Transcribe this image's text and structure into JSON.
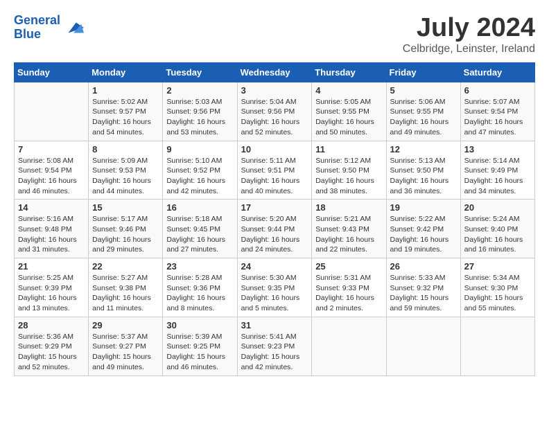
{
  "header": {
    "logo_line1": "General",
    "logo_line2": "Blue",
    "month_title": "July 2024",
    "subtitle": "Celbridge, Leinster, Ireland"
  },
  "days_of_week": [
    "Sunday",
    "Monday",
    "Tuesday",
    "Wednesday",
    "Thursday",
    "Friday",
    "Saturday"
  ],
  "weeks": [
    [
      {
        "day": "",
        "info": ""
      },
      {
        "day": "1",
        "info": "Sunrise: 5:02 AM\nSunset: 9:57 PM\nDaylight: 16 hours\nand 54 minutes."
      },
      {
        "day": "2",
        "info": "Sunrise: 5:03 AM\nSunset: 9:56 PM\nDaylight: 16 hours\nand 53 minutes."
      },
      {
        "day": "3",
        "info": "Sunrise: 5:04 AM\nSunset: 9:56 PM\nDaylight: 16 hours\nand 52 minutes."
      },
      {
        "day": "4",
        "info": "Sunrise: 5:05 AM\nSunset: 9:55 PM\nDaylight: 16 hours\nand 50 minutes."
      },
      {
        "day": "5",
        "info": "Sunrise: 5:06 AM\nSunset: 9:55 PM\nDaylight: 16 hours\nand 49 minutes."
      },
      {
        "day": "6",
        "info": "Sunrise: 5:07 AM\nSunset: 9:54 PM\nDaylight: 16 hours\nand 47 minutes."
      }
    ],
    [
      {
        "day": "7",
        "info": "Sunrise: 5:08 AM\nSunset: 9:54 PM\nDaylight: 16 hours\nand 46 minutes."
      },
      {
        "day": "8",
        "info": "Sunrise: 5:09 AM\nSunset: 9:53 PM\nDaylight: 16 hours\nand 44 minutes."
      },
      {
        "day": "9",
        "info": "Sunrise: 5:10 AM\nSunset: 9:52 PM\nDaylight: 16 hours\nand 42 minutes."
      },
      {
        "day": "10",
        "info": "Sunrise: 5:11 AM\nSunset: 9:51 PM\nDaylight: 16 hours\nand 40 minutes."
      },
      {
        "day": "11",
        "info": "Sunrise: 5:12 AM\nSunset: 9:50 PM\nDaylight: 16 hours\nand 38 minutes."
      },
      {
        "day": "12",
        "info": "Sunrise: 5:13 AM\nSunset: 9:50 PM\nDaylight: 16 hours\nand 36 minutes."
      },
      {
        "day": "13",
        "info": "Sunrise: 5:14 AM\nSunset: 9:49 PM\nDaylight: 16 hours\nand 34 minutes."
      }
    ],
    [
      {
        "day": "14",
        "info": "Sunrise: 5:16 AM\nSunset: 9:48 PM\nDaylight: 16 hours\nand 31 minutes."
      },
      {
        "day": "15",
        "info": "Sunrise: 5:17 AM\nSunset: 9:46 PM\nDaylight: 16 hours\nand 29 minutes."
      },
      {
        "day": "16",
        "info": "Sunrise: 5:18 AM\nSunset: 9:45 PM\nDaylight: 16 hours\nand 27 minutes."
      },
      {
        "day": "17",
        "info": "Sunrise: 5:20 AM\nSunset: 9:44 PM\nDaylight: 16 hours\nand 24 minutes."
      },
      {
        "day": "18",
        "info": "Sunrise: 5:21 AM\nSunset: 9:43 PM\nDaylight: 16 hours\nand 22 minutes."
      },
      {
        "day": "19",
        "info": "Sunrise: 5:22 AM\nSunset: 9:42 PM\nDaylight: 16 hours\nand 19 minutes."
      },
      {
        "day": "20",
        "info": "Sunrise: 5:24 AM\nSunset: 9:40 PM\nDaylight: 16 hours\nand 16 minutes."
      }
    ],
    [
      {
        "day": "21",
        "info": "Sunrise: 5:25 AM\nSunset: 9:39 PM\nDaylight: 16 hours\nand 13 minutes."
      },
      {
        "day": "22",
        "info": "Sunrise: 5:27 AM\nSunset: 9:38 PM\nDaylight: 16 hours\nand 11 minutes."
      },
      {
        "day": "23",
        "info": "Sunrise: 5:28 AM\nSunset: 9:36 PM\nDaylight: 16 hours\nand 8 minutes."
      },
      {
        "day": "24",
        "info": "Sunrise: 5:30 AM\nSunset: 9:35 PM\nDaylight: 16 hours\nand 5 minutes."
      },
      {
        "day": "25",
        "info": "Sunrise: 5:31 AM\nSunset: 9:33 PM\nDaylight: 16 hours\nand 2 minutes."
      },
      {
        "day": "26",
        "info": "Sunrise: 5:33 AM\nSunset: 9:32 PM\nDaylight: 15 hours\nand 59 minutes."
      },
      {
        "day": "27",
        "info": "Sunrise: 5:34 AM\nSunset: 9:30 PM\nDaylight: 15 hours\nand 55 minutes."
      }
    ],
    [
      {
        "day": "28",
        "info": "Sunrise: 5:36 AM\nSunset: 9:29 PM\nDaylight: 15 hours\nand 52 minutes."
      },
      {
        "day": "29",
        "info": "Sunrise: 5:37 AM\nSunset: 9:27 PM\nDaylight: 15 hours\nand 49 minutes."
      },
      {
        "day": "30",
        "info": "Sunrise: 5:39 AM\nSunset: 9:25 PM\nDaylight: 15 hours\nand 46 minutes."
      },
      {
        "day": "31",
        "info": "Sunrise: 5:41 AM\nSunset: 9:23 PM\nDaylight: 15 hours\nand 42 minutes."
      },
      {
        "day": "",
        "info": ""
      },
      {
        "day": "",
        "info": ""
      },
      {
        "day": "",
        "info": ""
      }
    ]
  ]
}
